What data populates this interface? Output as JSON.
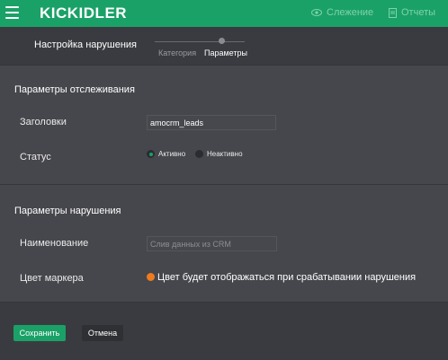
{
  "app": {
    "logo": "KICKIDLER"
  },
  "topbar": {
    "watch_label": "Слежение",
    "reports_label": "Отчеты"
  },
  "header": {
    "title": "Настройка нарушения",
    "steps": [
      "Категория",
      "Параметры"
    ],
    "active_step": "Параметры"
  },
  "tracking": {
    "section_title": "Параметры отслеживания",
    "headers_label": "Заголовки",
    "headers_value": "amocrm_leads",
    "status_label": "Статус",
    "status_options": [
      "Активно",
      "Неактивно"
    ],
    "status_selected": "Активно"
  },
  "violation": {
    "section_title": "Параметры нарушения",
    "name_label": "Наименование",
    "name_placeholder": "Слив данных из CRM",
    "marker_label": "Цвет маркера",
    "marker_color": "#f07b1f",
    "marker_text": "Цвет будет отображаться при срабатывании нарушения"
  },
  "actions": {
    "save_label": "Сохранить",
    "cancel_label": "Отмена"
  },
  "colors": {
    "brand": "#1aa167",
    "background": "#3a3b40",
    "panel": "#46474c"
  }
}
